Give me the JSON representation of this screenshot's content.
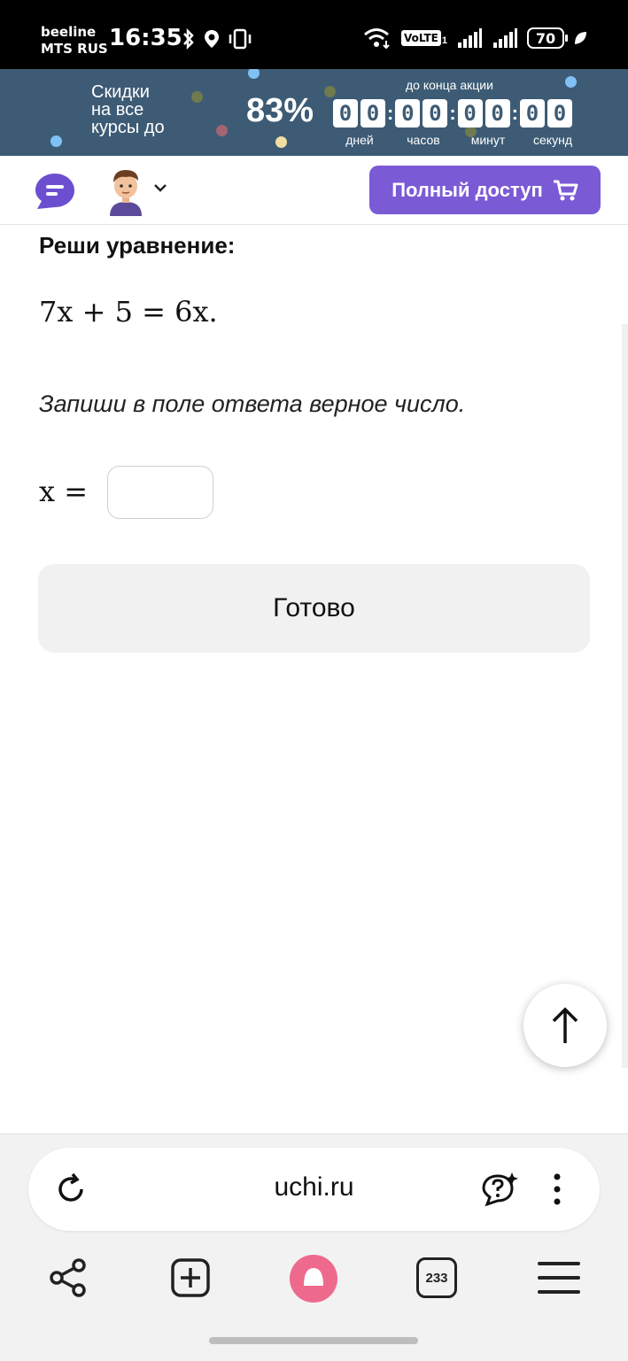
{
  "status_bar": {
    "carrier_1": "beeline",
    "carrier_2": "MTS RUS",
    "time": "16:35",
    "volte": "VoLTE",
    "sim_index": "1",
    "battery": "70"
  },
  "promo": {
    "text_line1": "Скидки",
    "text_line2": "на все",
    "text_line3": "курсы до",
    "percent": "83%",
    "until_label": "до конца акции",
    "timer": {
      "days": [
        "0",
        "0"
      ],
      "hours": [
        "0",
        "0"
      ],
      "minutes": [
        "0",
        "0"
      ],
      "seconds": [
        "0",
        "0"
      ],
      "labels": [
        "дней",
        "часов",
        "минут",
        "секунд"
      ]
    },
    "colors": {
      "background": "#3d5b75"
    }
  },
  "header": {
    "chat_icon": "chat-bubble-icon",
    "avatar_icon": "boy-avatar-icon",
    "full_access_label": "Полный доступ",
    "cart_icon": "cart-icon",
    "accent": "#7b5ad6"
  },
  "task": {
    "title": "Реши уравнение:",
    "equation": "7x + 5 = 6x.",
    "hint": "Запиши в поле ответа верное число.",
    "answer_label": "x =",
    "answer_value": "",
    "done_label": "Готово"
  },
  "browser": {
    "url": "uchi.ru",
    "tabs_count": "233",
    "icons": [
      "reload-icon",
      "assistant-icon",
      "more-icon",
      "share-icon",
      "new-tab-icon",
      "alice-icon",
      "tabs-icon",
      "menu-icon"
    ]
  }
}
